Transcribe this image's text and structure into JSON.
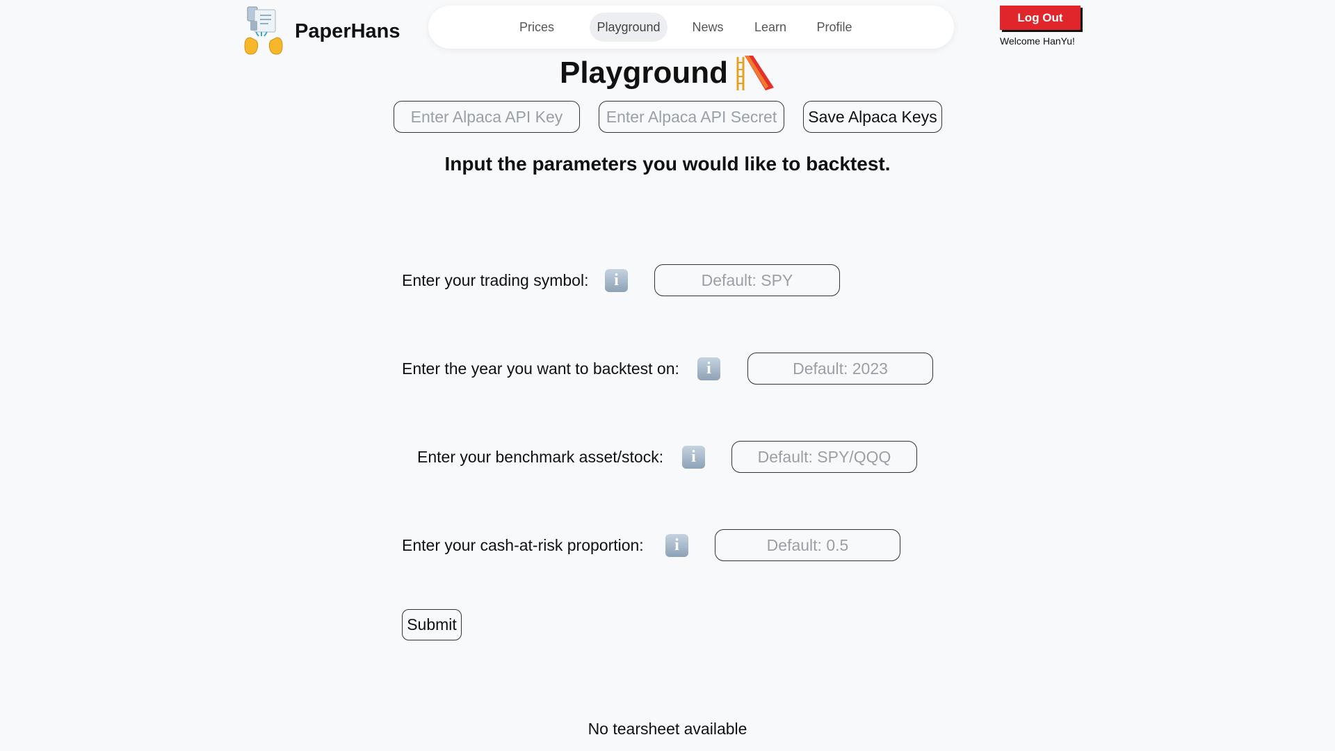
{
  "brand": {
    "name": "PaperHans",
    "logo_icon": "paper-hands-icon"
  },
  "nav": {
    "items": [
      {
        "label": "Prices"
      },
      {
        "label": "Playground"
      },
      {
        "label": "News"
      },
      {
        "label": "Learn"
      },
      {
        "label": "Profile"
      }
    ],
    "active": "Playground"
  },
  "user": {
    "logout_label": "Log Out",
    "welcome": "Welcome HanYu!"
  },
  "page": {
    "title": "Playground",
    "title_icon": "playground-slide-icon"
  },
  "alpaca": {
    "key_placeholder": "Enter Alpaca API Key",
    "secret_placeholder": "Enter Alpaca API Secret",
    "save_label": "Save Alpaca Keys"
  },
  "form": {
    "heading": "Input the parameters you would like to backtest.",
    "symbol": {
      "label": "Enter your trading symbol:",
      "placeholder": "Default: SPY",
      "info_glyph": "i"
    },
    "year": {
      "label": "Enter the year you want to backtest on:",
      "placeholder": "Default: 2023",
      "info_glyph": "i"
    },
    "benchmark": {
      "label": "Enter your benchmark asset/stock:",
      "placeholder": "Default: SPY/QQQ",
      "info_glyph": "i"
    },
    "cash": {
      "label": "Enter your cash-at-risk proportion:",
      "placeholder": "Default: 0.5",
      "info_glyph": "i"
    },
    "submit_label": "Submit"
  },
  "result": {
    "message": "No tearsheet available"
  },
  "colors": {
    "logout": "#e0262b",
    "background": "#f8f9fb",
    "nav_active": "#eceef2"
  }
}
